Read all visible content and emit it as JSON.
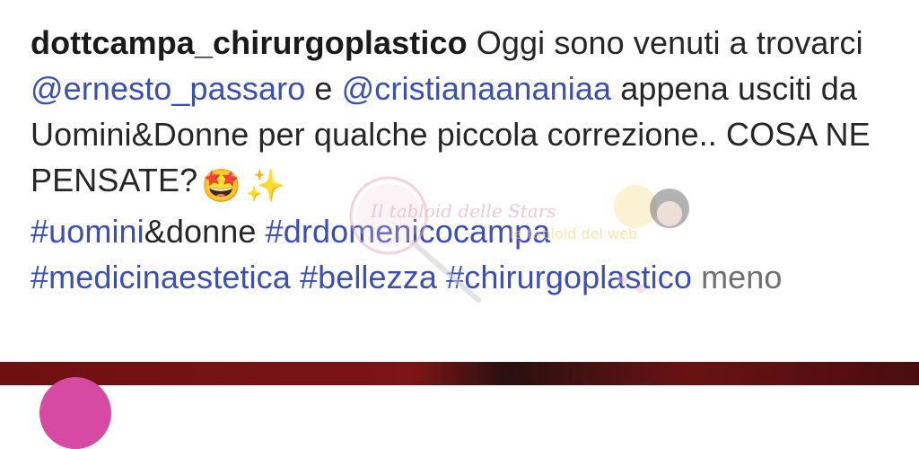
{
  "post": {
    "username": "dottcampa_chirurgoplastico",
    "text_1": " Oggi sono venuti a trovarci ",
    "mention_1": "@ernesto_passaro",
    "text_2": " e ",
    "mention_2": "@cristianaananiaa",
    "text_3": " appena usciti da Uomini&Donne per qualche piccola correzione.. COSA NE PENSATE?",
    "emoji_star_eyes": "🤩",
    "emoji_sparkles": "✨",
    "hashtags": [
      "#uomini",
      "&donne",
      "#drdomenicocampa",
      "#medicinaestetica",
      "#bellezza",
      "#chirurgoplastico"
    ],
    "more_label": "meno"
  },
  "watermark": {
    "text_main": "Il tabloid delle Stars",
    "text_sub": "le tabloid del web"
  },
  "colors": {
    "text": "#262626",
    "link": "#3b4fb4",
    "muted": "#6f6f6f",
    "strip": "#6e1010"
  }
}
